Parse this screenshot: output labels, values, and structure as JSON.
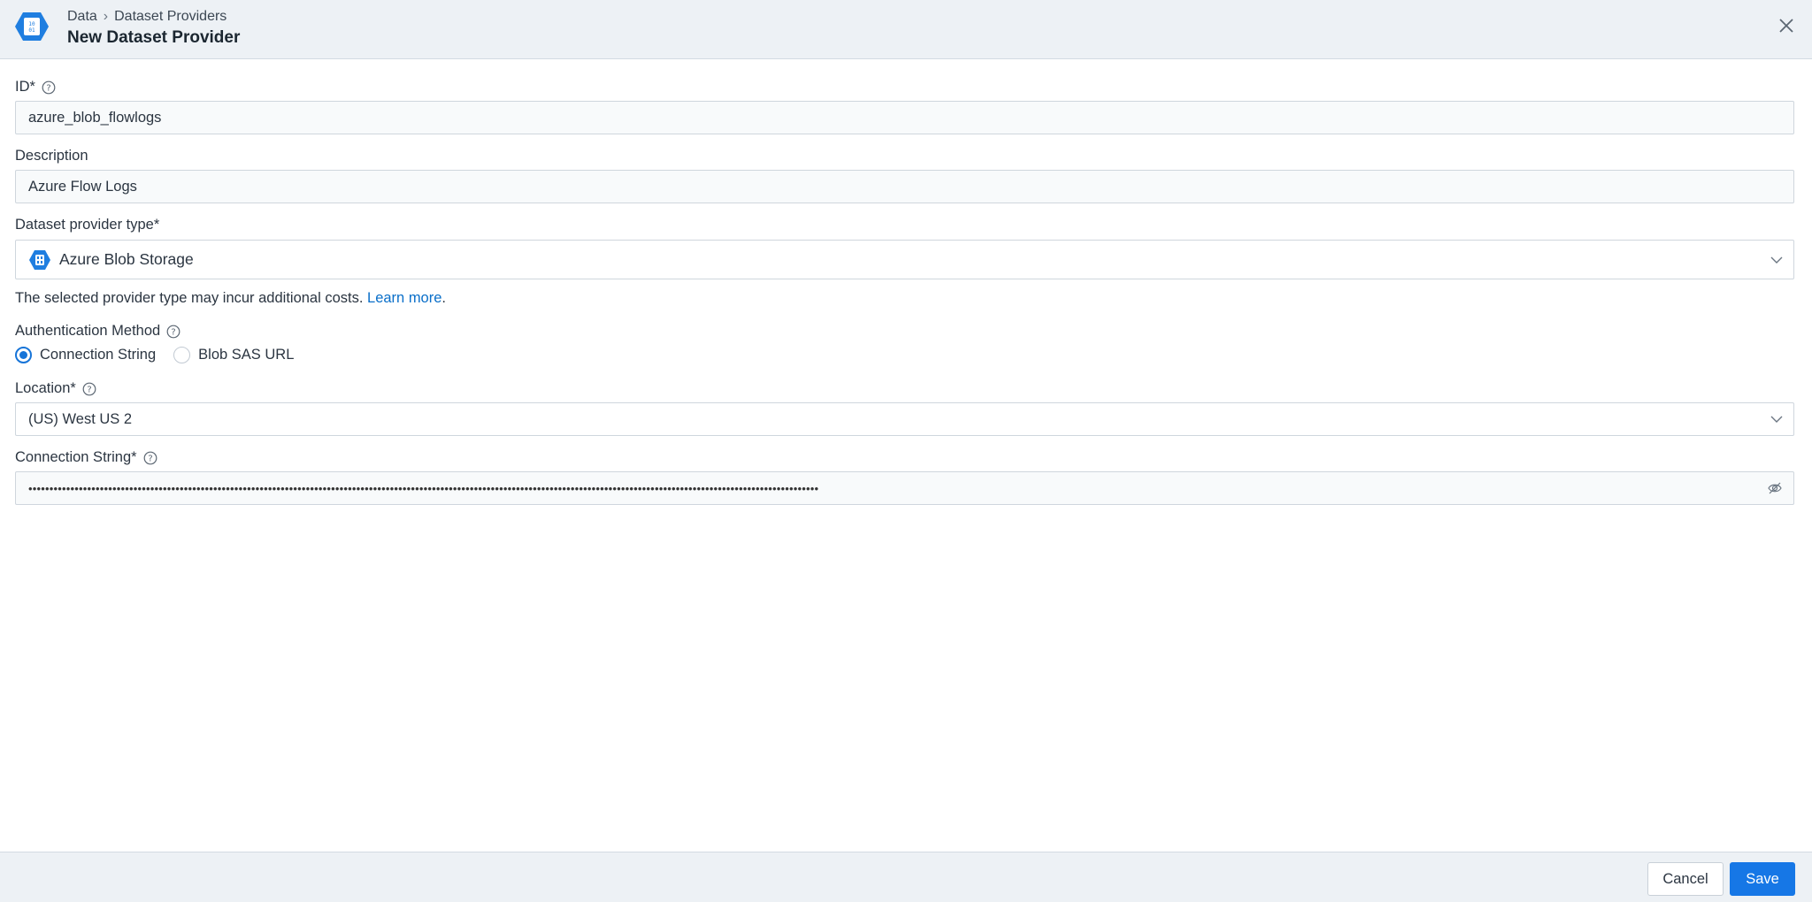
{
  "header": {
    "breadcrumb": [
      "Data",
      "Dataset Providers"
    ],
    "breadcrumb_separator": "›",
    "title": "New Dataset Provider",
    "app_icon": "azure-blob-hex-icon",
    "close_icon": "close-icon"
  },
  "form": {
    "id_field": {
      "label": "ID*",
      "value": "azure_blob_flowlogs"
    },
    "description_field": {
      "label": "Description",
      "value": "Azure Flow Logs"
    },
    "provider_type": {
      "label": "Dataset provider type*",
      "value": "Azure Blob Storage",
      "icon": "azure-blob-icon"
    },
    "cost_note": {
      "text": "The selected provider type may incur additional costs. ",
      "link": "Learn more",
      "suffix": "."
    },
    "auth_method": {
      "label": "Authentication Method",
      "options": [
        {
          "label": "Connection String",
          "selected": true
        },
        {
          "label": "Blob SAS URL",
          "selected": false
        }
      ]
    },
    "location": {
      "label": "Location*",
      "value": "(US) West US 2"
    },
    "connection_string": {
      "label": "Connection String*",
      "masked_value": "••••••••••••••••••••••••••••••••••••••••••••••••••••••••••••••••••••••••••••••••••••••••••••••••••••••••••••••••••••••••••••••••••••••••••••••••••••••••••••••••••••••••••••••••••••••••••••"
    }
  },
  "footer": {
    "cancel_label": "Cancel",
    "save_label": "Save"
  },
  "colors": {
    "accent": "#1677e6",
    "header_bg": "#edf1f5",
    "link": "#0a6fc9"
  }
}
